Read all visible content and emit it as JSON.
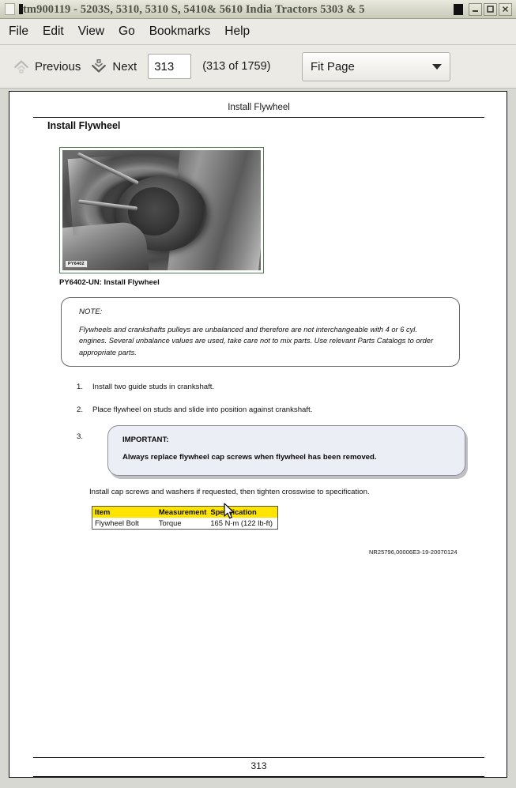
{
  "window": {
    "title": "tm900119 - 5203S, 5310, 5310 S, 5410& 5610 India Tractors 5303 & 5",
    "app_icon": "document-icon",
    "minimize_icon": "minimize-icon",
    "maximize_icon": "maximize-icon",
    "close_icon": "close-icon"
  },
  "menubar": {
    "items": [
      {
        "label": "File"
      },
      {
        "label": "Edit"
      },
      {
        "label": "View"
      },
      {
        "label": "Go"
      },
      {
        "label": "Bookmarks"
      },
      {
        "label": "Help"
      }
    ]
  },
  "toolbar": {
    "previous_label": "Previous",
    "previous_icon": "chevron-up-icon",
    "next_label": "Next",
    "next_icon": "chevron-down-icon",
    "page_input_value": "313",
    "page_input_placeholder": "",
    "page_count_label": "(313 of 1759)",
    "zoom_value": "Fit Page",
    "zoom_caret_icon": "caret-down-icon"
  },
  "document": {
    "running_head": "Install Flywheel",
    "page_number_footer": "313",
    "section_title": "Install Flywheel",
    "figure": {
      "tag": "PY6402",
      "caption": "PY6402-UN: Install Flywheel",
      "border_color": "#4e7b4e"
    },
    "note": {
      "title": "NOTE:",
      "body": "Flywheels and crankshafts pulleys are unbalanced and therefore are not interchangeable with 4 or 6 cyl. engines. Several unbalance values are used, take care not to mix parts. Use relevant Parts Catalogs to order appropriate parts."
    },
    "steps": [
      {
        "num": "1.",
        "text": "Install two guide studs in crankshaft."
      },
      {
        "num": "2.",
        "text": "Place flywheel on studs and slide into position against crankshaft."
      },
      {
        "num": "3.",
        "text": ""
      }
    ],
    "important": {
      "title": "IMPORTANT:",
      "body": "Always replace flywheel cap screws when flywheel has been removed."
    },
    "paragraph": "Install cap screws and washers if requested, then tighten crosswise to specification.",
    "spec_table": {
      "headers": [
        "Item",
        "Measurement",
        "Specification"
      ],
      "header_bg": "#ffe400",
      "rows": [
        {
          "item": "Flywheel Bolt",
          "measurement": "Torque",
          "specification": "165 N·m (122 lb-ft)"
        }
      ]
    },
    "doc_id": "NR25796,00006E3-19-20070124"
  },
  "cursor": {
    "icon": "mouse-pointer-icon"
  }
}
